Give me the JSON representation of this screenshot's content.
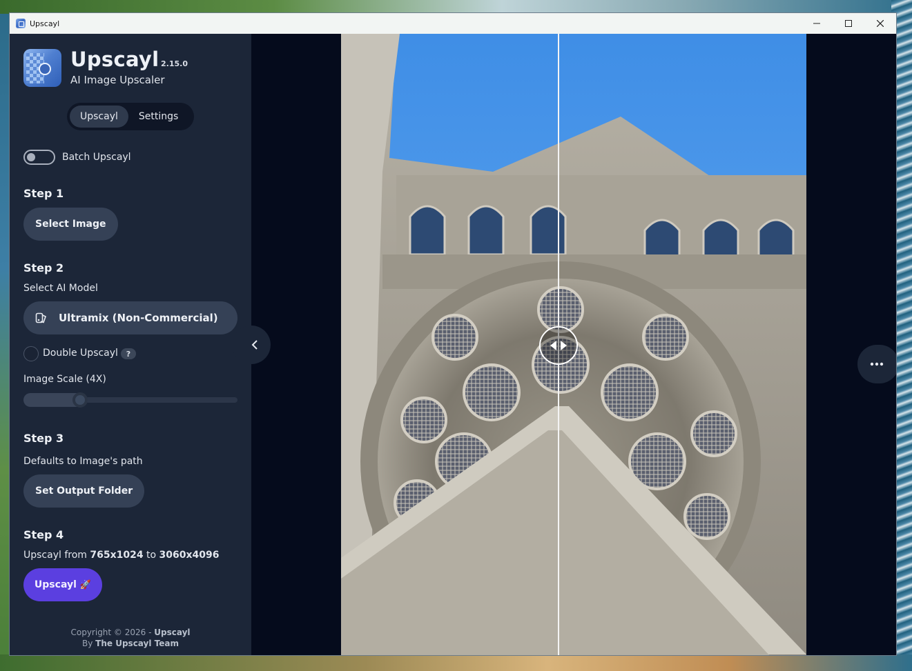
{
  "window": {
    "title": "Upscayl",
    "controls": [
      "minimize",
      "maximize",
      "close"
    ]
  },
  "app": {
    "name": "Upscayl",
    "version": "2.15.0",
    "subtitle": "AI Image Upscaler"
  },
  "tabs": [
    {
      "label": "Upscayl",
      "active": true
    },
    {
      "label": "Settings",
      "active": false
    }
  ],
  "batch": {
    "label": "Batch Upscayl",
    "enabled": false
  },
  "step1": {
    "title": "Step 1",
    "button": "Select Image"
  },
  "step2": {
    "title": "Step 2",
    "subtitle": "Select AI Model",
    "model": "Ultramix (Non-Commercial)",
    "double_upscayl": "Double Upscayl",
    "help": "?",
    "scale_label": "Image Scale (4X)",
    "scale_fraction": 0.23
  },
  "step3": {
    "title": "Step 3",
    "subtitle": "Defaults to Image's path",
    "button": "Set Output Folder"
  },
  "step4": {
    "title": "Step 4",
    "prefix": "Upscayl from ",
    "from": "765x1024",
    "mid": " to ",
    "to": "3060x4096",
    "button": "Upscayl",
    "button_icon": "rocket-icon"
  },
  "footer": {
    "copyright": "Copyright © 2026 - ",
    "brand": "Upscayl",
    "by": "By ",
    "team": "The Upscayl Team"
  },
  "compare": {
    "divider_fraction": 0.467
  },
  "colors": {
    "sidebar": "#1c2638",
    "accent": "#5b3fe0",
    "pill": "#354156",
    "background": "#050b1c"
  }
}
